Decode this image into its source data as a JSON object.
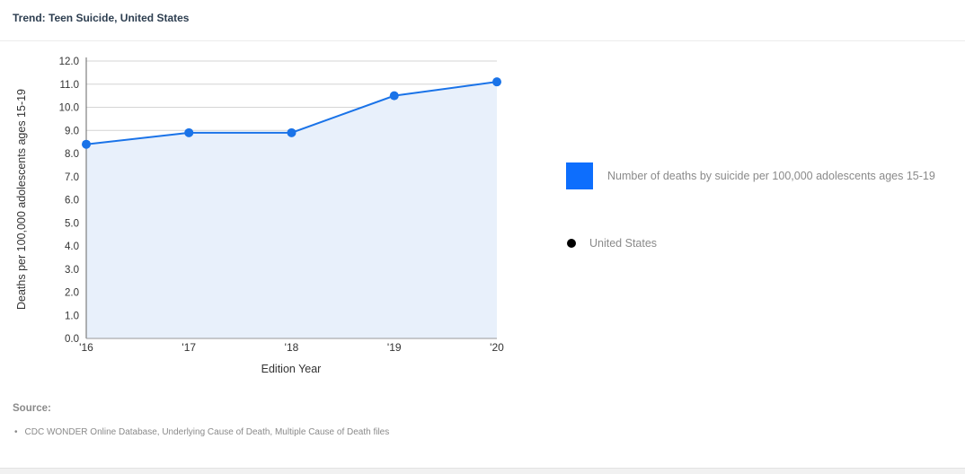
{
  "header": {
    "title": "Trend: Teen Suicide, United States"
  },
  "chart_data": {
    "type": "area",
    "title": "",
    "xlabel": "Edition Year",
    "ylabel": "Deaths per 100,000 adolescents ages 15-19",
    "categories": [
      "'16",
      "'17",
      "'18",
      "'19",
      "'20"
    ],
    "series": [
      {
        "name": "United States",
        "values": [
          8.4,
          8.9,
          8.9,
          10.5,
          11.1
        ]
      }
    ],
    "ylim": [
      0,
      12
    ],
    "yticks": [
      "0.0",
      "1.0",
      "2.0",
      "3.0",
      "4.0",
      "5.0",
      "6.0",
      "7.0",
      "8.0",
      "9.0",
      "10.0",
      "11.0",
      "12.0"
    ],
    "grid": true,
    "legend_position": "right",
    "colors": {
      "line": "#1a73e8",
      "fill": "#e8f0fb",
      "point": "#1a73e8",
      "grid": "#d4d4d4"
    }
  },
  "legend": {
    "measure_label": "Number of deaths by suicide per 100,000 adolescents ages 15-19",
    "measure_color": "#0d6efd",
    "location_label": "United States",
    "location_color": "#000000"
  },
  "source": {
    "heading": "Source:",
    "items": [
      "CDC WONDER Online Database, Underlying Cause of Death, Multiple Cause of Death files"
    ]
  }
}
